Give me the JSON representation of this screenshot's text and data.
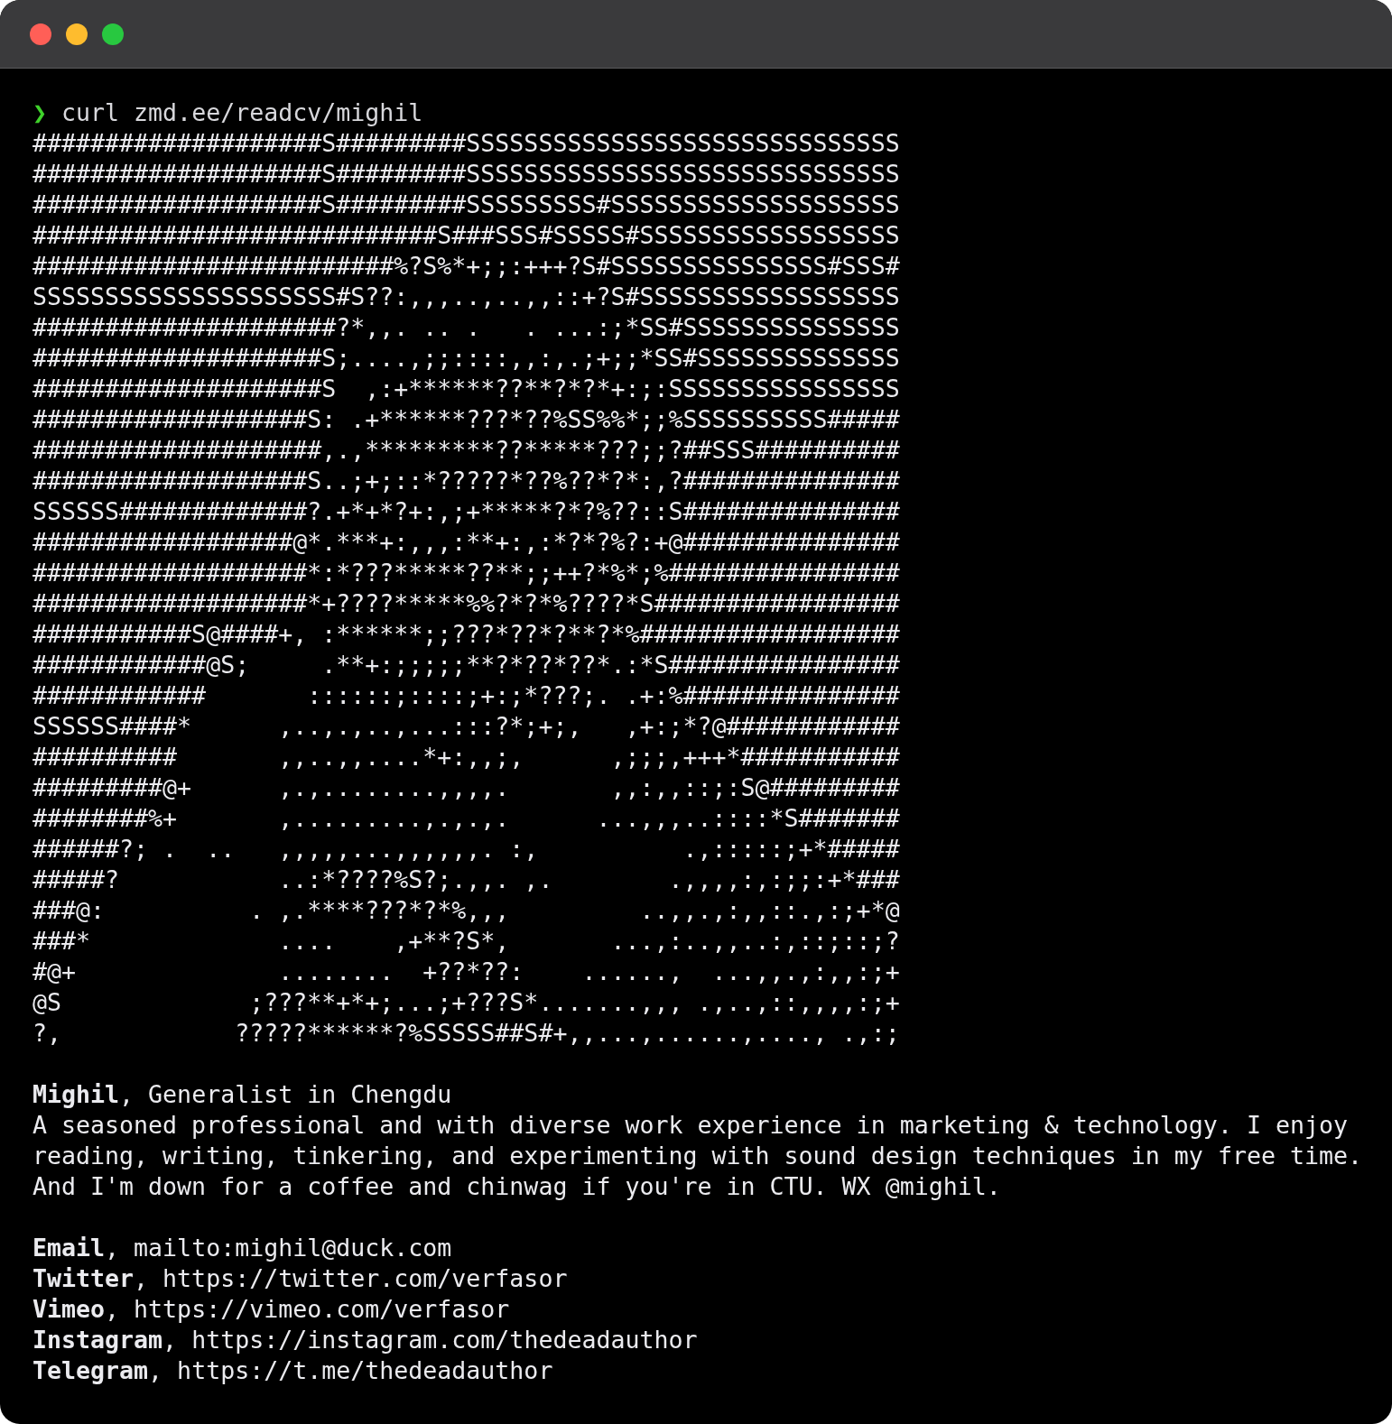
{
  "window": {
    "controls": [
      {
        "color": "#ff5f57"
      },
      {
        "color": "#febc2e"
      },
      {
        "color": "#28c840"
      }
    ]
  },
  "prompt": {
    "symbol": "❯",
    "command": "curl zmd.ee/readcv/mighil"
  },
  "ascii_art": [
    "####################S#########SSSSSSSSSSSSSSSSSSSSSSSSSSSSSS",
    "####################S#########SSSSSSSSSSSSSSSSSSSSSSSSSSSSSS",
    "####################S#########SSSSSSSSS#SSSSSSSSSSSSSSSSSSSS",
    "############################S###SSS#SSSSS#SSSSSSSSSSSSSSSSSS",
    "#########################%?S%*+;;:+++?S#SSSSSSSSSSSSSSS#SSS#",
    "SSSSSSSSSSSSSSSSSSSSS#S??:,,,..,..,,::+?S#SSSSSSSSSSSSSSSSSS",
    "#####################?*,,. .. .   . ...:;*SS#SSSSSSSSSSSSSSS",
    "####################S;....,;;::::,,:,.;+;;*SS#SSSSSSSSSSSSSS",
    "####################S  ,:+******??**?*?*+:;:SSSSSSSSSSSSSSSS",
    "###################S: .+******???*??%SS%%*;;%SSSSSSSSSS#####",
    "####################,.,*********??*****???;;?##SSS##########",
    "###################S..;+;::*?????*??%??*?*:,?###############",
    "SSSSSS#############?.+*+*?+:,;+*****?*?%??::S###############",
    "##################@*.***+:,,,:**+:,:*?*?%?:+@###############",
    "###################*:*???*****??**;;++?*%*;%################",
    "###################*+????*****%%?*?*%????*S#################",
    "###########S@####+, :******;;???*??*?**?*%##################",
    "############@S;     .**+:;;;;;**?*??*??*.:*S################",
    "############       ::::::;::::;+:;*???;. .+:%###############",
    "SSSSSS####*      ,..,.,..,...:::?*;+;,   ,+:;*?@############",
    "##########       ,,..,,....*+:,,;,      ,;;;,+++*###########",
    "#########@+      ,.,........,,,,.       ,,:,,::;:S@#########",
    "########%+       ,.........,.,.,.      ...,,,..::::*S#######",
    "######?; .  ..   ,,,,,...,,,,,,. :,          .,:::::;+*#####",
    "#####?           ..:*????%S?;.,,. ,.        .,,,,:,:;;:+*###",
    "###@:          . ,.****???*?*%,,,         ..,,.,:,,::.,:;+*@",
    "###*             ....    ,+**?S*,       ...,:..,,..:,::;::;?",
    "#@+              ........  +??*??:    ......,  ...,,.,:,,:;+",
    "@S             ;???**+*+;...;+???S*.......,,, .,..,::,,,,:;+",
    "?,            ?????******?%SSSSS##S#+,,...,......,...., .,:;"
  ],
  "profile": {
    "headline": "**Mighil**, Generalist in Chengdu",
    "bio": "A seasoned professional and with diverse work experience in marketing & technology. I enjoy reading, writing, tinkering, and experimenting with sound design techniques in my free time. And I'm down for a coffee and chinwag if you're in CTU. WX @mighil."
  },
  "contacts": [
    "**Email**, mailto:mighil@duck.com",
    "**Twitter**, https://twitter.com/verfasor",
    "**Vimeo**, https://vimeo.com/verfasor",
    "**Instagram**, https://instagram.com/thedeadauthor",
    "**Telegram**, https://t.me/thedeadauthor"
  ]
}
